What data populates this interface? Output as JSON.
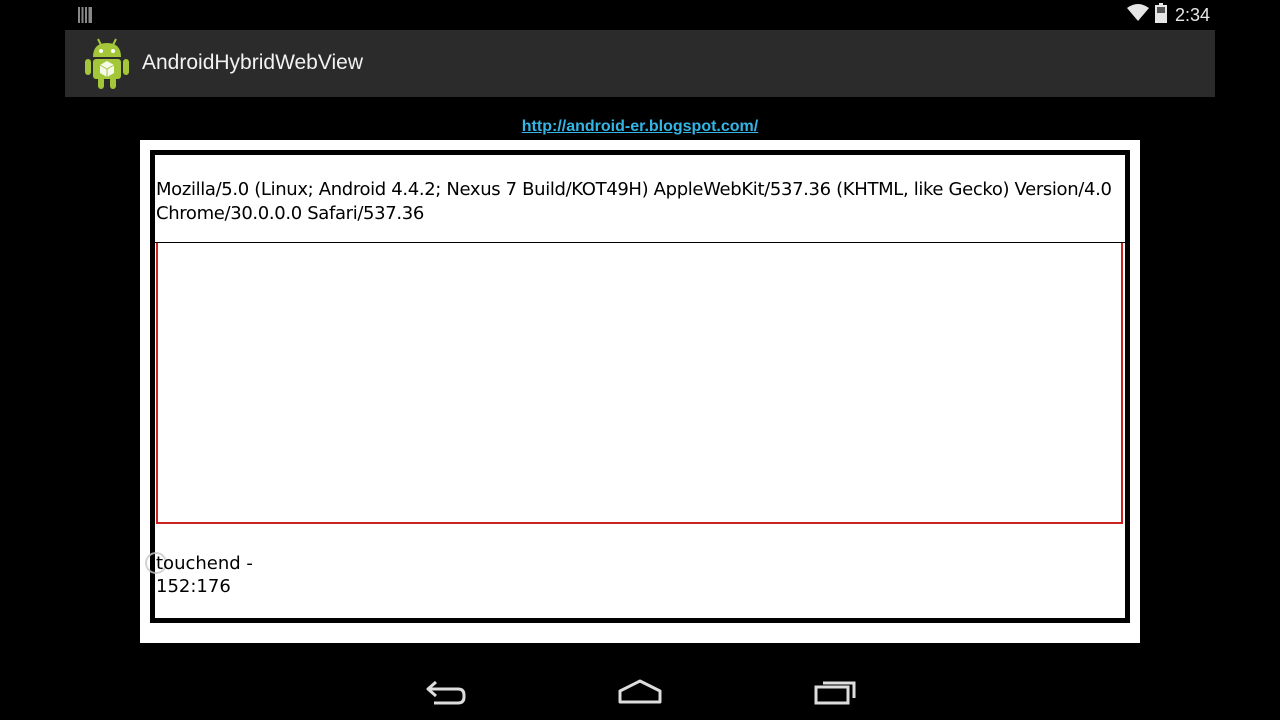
{
  "status_bar": {
    "time": "2:34",
    "icons": [
      "notification-icon",
      "wifi-icon",
      "battery-icon"
    ]
  },
  "action_bar": {
    "title": "AndroidHybridWebView",
    "icon": "android-robot-icon"
  },
  "webview": {
    "link": "http://android-er.blogspot.com/",
    "user_agent_line1": "Mozilla/5.0 (Linux; Android 4.4.2; Nexus 7 Build/KOT49H) AppleWebKit/537.36 (KHTML, like Gecko) Version/4.0",
    "user_agent_line2": "Chrome/30.0.0.0 Safari/537.36",
    "event_line1": "touchend -",
    "event_line2": "152:176"
  },
  "nav_bar": {
    "buttons": [
      "back-icon",
      "home-icon",
      "recents-icon"
    ]
  },
  "colors": {
    "link": "#33b5e5",
    "canvas_border": "#cc2222",
    "action_bar_bg": "#2b2b2b"
  }
}
